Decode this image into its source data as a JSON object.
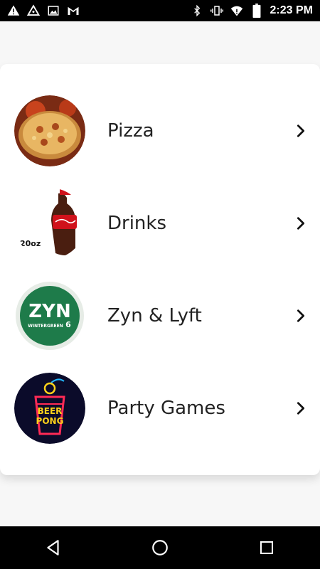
{
  "status_bar": {
    "time": "2:23 PM",
    "left_icons": [
      "warning-icon",
      "triangle-warning-icon",
      "image-icon",
      "gmail-icon"
    ],
    "right_icons": [
      "bluetooth-icon",
      "vibrate-icon",
      "wifi-icon",
      "battery-icon"
    ]
  },
  "menu": {
    "items": [
      {
        "label": "Pizza",
        "icon": "pizza-image"
      },
      {
        "label": "Drinks",
        "icon": "coca-cola-bottle-image",
        "badge": "20oz"
      },
      {
        "label": "Zyn & Lyft",
        "icon": "zyn-tin-image",
        "brand": "ZYN",
        "flavor": "WINTERGREEN",
        "strength": "6"
      },
      {
        "label": "Party Games",
        "icon": "beer-pong-image",
        "sign_line1": "BEER",
        "sign_line2": "PONG"
      }
    ]
  },
  "colors": {
    "zyn_green": "#1e7b4a",
    "coke_red": "#d0121b",
    "neon_red": "#ff2a55",
    "neon_yellow": "#ffd21a",
    "neon_blue": "#22b7ff"
  }
}
